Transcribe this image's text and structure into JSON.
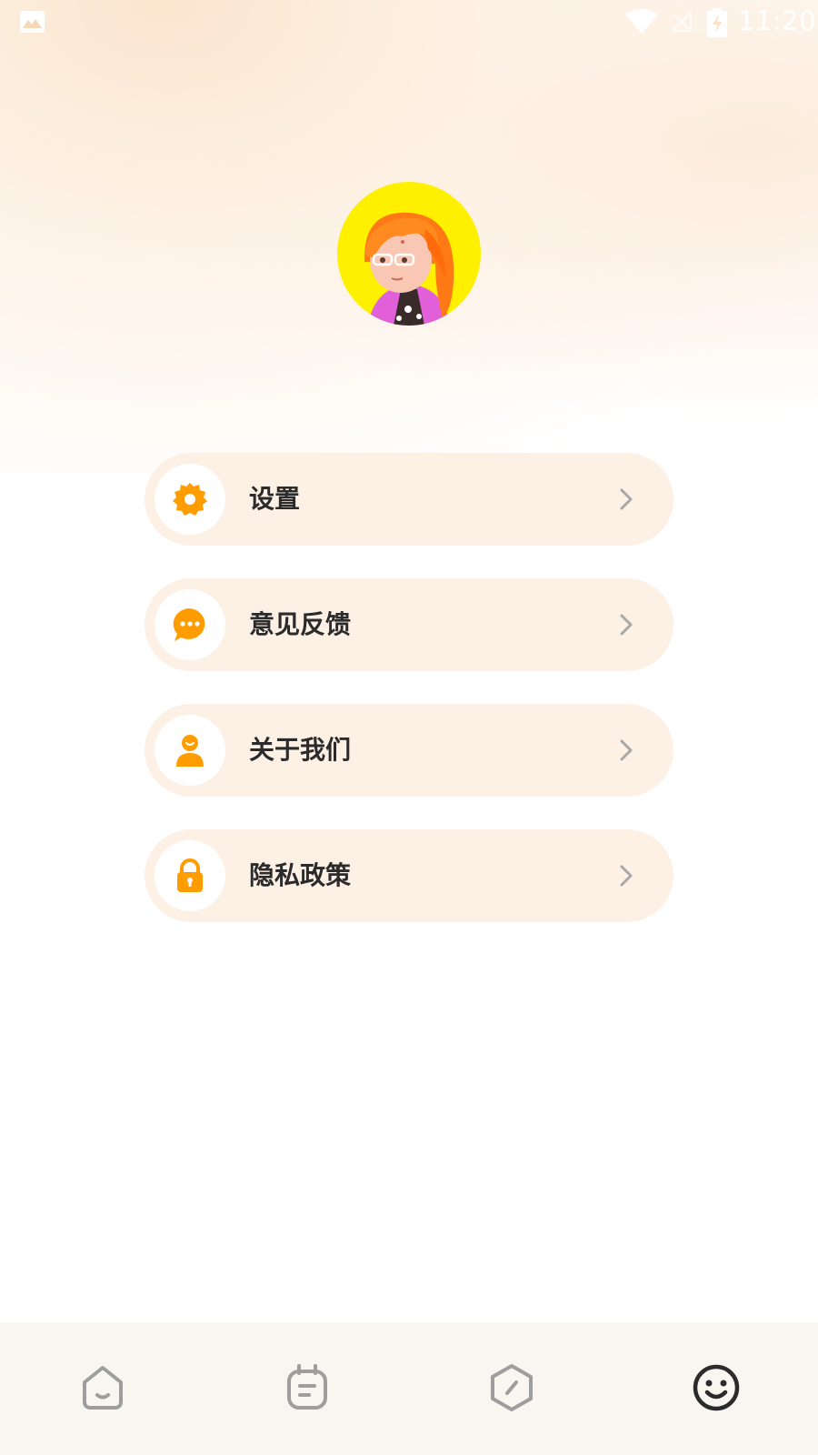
{
  "status_bar": {
    "time": "11:20",
    "icons": [
      "gallery-icon",
      "wifi-icon",
      "no-signal-icon",
      "battery-charging-icon"
    ]
  },
  "profile": {
    "avatar": "avatar-cartoon-girl"
  },
  "menu": {
    "items": [
      {
        "label": "设置",
        "icon": "gear-icon"
      },
      {
        "label": "意见反馈",
        "icon": "chat-bubble-icon"
      },
      {
        "label": "关于我们",
        "icon": "person-icon"
      },
      {
        "label": "隐私政策",
        "icon": "lock-icon"
      }
    ]
  },
  "tabbar": {
    "tabs": [
      {
        "icon": "home-icon",
        "active": false
      },
      {
        "icon": "notes-icon",
        "active": false
      },
      {
        "icon": "compass-icon",
        "active": false
      },
      {
        "icon": "smiley-profile-icon",
        "active": true
      }
    ]
  },
  "colors": {
    "accent": "#ff9c00",
    "menu_bg": "#fdf0e5",
    "avatar_bg": "#fff000",
    "text": "#2b2b2b",
    "tab_active": "#2b2b2b",
    "tab_inactive": "#9e9e9e"
  }
}
